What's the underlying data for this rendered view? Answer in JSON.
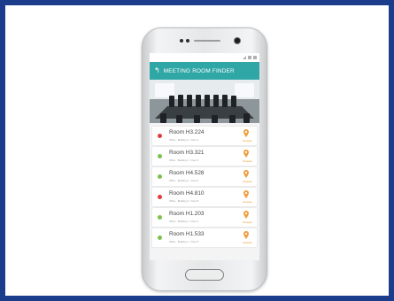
{
  "app": {
    "title": "MEETING ROOM FINDER"
  },
  "rooms": [
    {
      "name": "Room H3.224",
      "meta": "Office · Building 3 · Floor 2",
      "status": "busy",
      "action": "Navigate"
    },
    {
      "name": "Room H3.321",
      "meta": "Office · Building 3 · Floor 3",
      "status": "available",
      "action": "Navigate"
    },
    {
      "name": "Room H4.528",
      "meta": "Office · Building 4 · Floor 5",
      "status": "available",
      "action": "Navigate"
    },
    {
      "name": "Room H4.810",
      "meta": "Office · Building 4 · Floor 8",
      "status": "busy",
      "action": "Navigate"
    },
    {
      "name": "Room H1.203",
      "meta": "Office · Building 1 · Floor 2",
      "status": "available",
      "action": "Navigate"
    },
    {
      "name": "Room H1.533",
      "meta": "Office · Building 1 · Floor 5",
      "status": "available",
      "action": "Navigate"
    }
  ],
  "colors": {
    "frame_border": "#1c3d8c",
    "app_bar": "#2fa7a6",
    "status_busy": "#e23b3b",
    "status_available": "#7cc24a",
    "pin": "#f0a040"
  },
  "icons": {
    "back": "back-arrow-icon",
    "location": "location-pin-icon"
  }
}
